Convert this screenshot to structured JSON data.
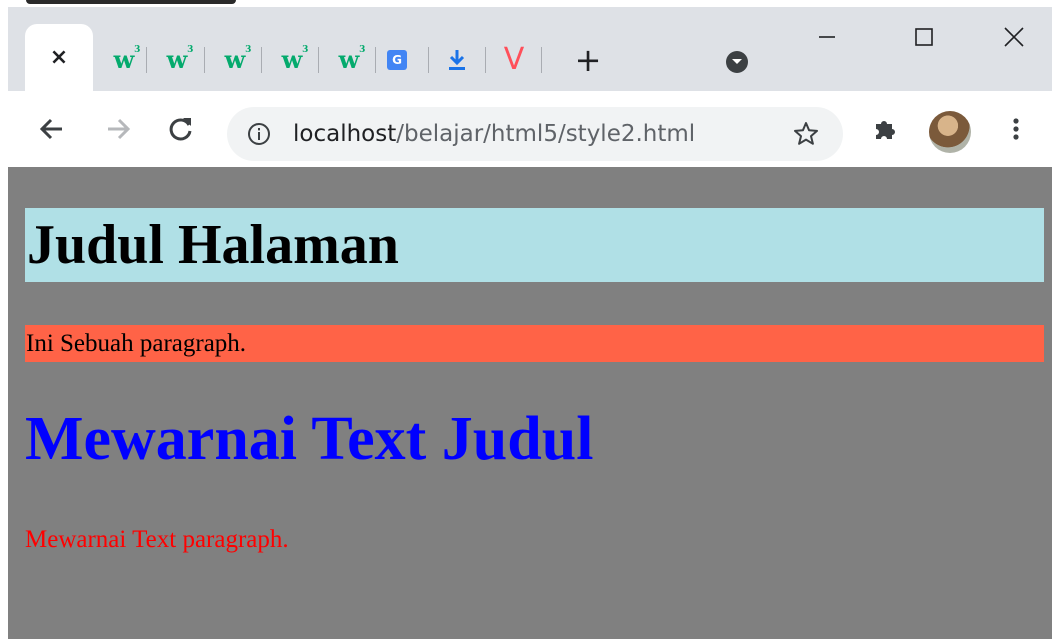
{
  "browser": {
    "active_tab": {
      "close_glyph": "×"
    },
    "pinned_tabs": [
      {
        "icon": "w3schools-icon",
        "text": "w",
        "sup": "3"
      },
      {
        "icon": "w3schools-icon",
        "text": "w",
        "sup": "3"
      },
      {
        "icon": "w3schools-icon",
        "text": "w",
        "sup": "3"
      },
      {
        "icon": "w3schools-icon",
        "text": "w",
        "sup": "3"
      },
      {
        "icon": "w3schools-icon",
        "text": "w",
        "sup": "3"
      },
      {
        "icon": "google-translate-icon",
        "text": "G"
      },
      {
        "icon": "download-icon"
      },
      {
        "icon": "vivaldi-icon",
        "text": "V"
      }
    ],
    "new_tab_glyph": "+",
    "toolbar": {
      "back_icon": "back-arrow-icon",
      "forward_icon": "forward-arrow-icon",
      "reload_icon": "reload-icon",
      "address": {
        "host": "localhost",
        "path": "/belajar/html5/style2.html"
      },
      "bookmark_icon": "star-icon",
      "extensions_icon": "puzzle-icon",
      "profile_icon": "avatar",
      "menu_icon": "kebab-menu-icon"
    },
    "colors": {
      "tab_strip": "#dee1e6",
      "toolbar": "#ffffff",
      "omnibox": "#f1f3f4"
    }
  },
  "page": {
    "heading": "Judul Halaman",
    "paragraph": "Ini Sebuah paragraph.",
    "colored_heading": "Mewarnai Text Judul",
    "colored_paragraph": "Mewarnai Text paragraph.",
    "colors": {
      "background": "#808080",
      "heading_bg": "#b0e0e6",
      "paragraph_bg": "#ff6347",
      "colored_heading": "#0000ff",
      "colored_paragraph": "#ff0000"
    }
  }
}
